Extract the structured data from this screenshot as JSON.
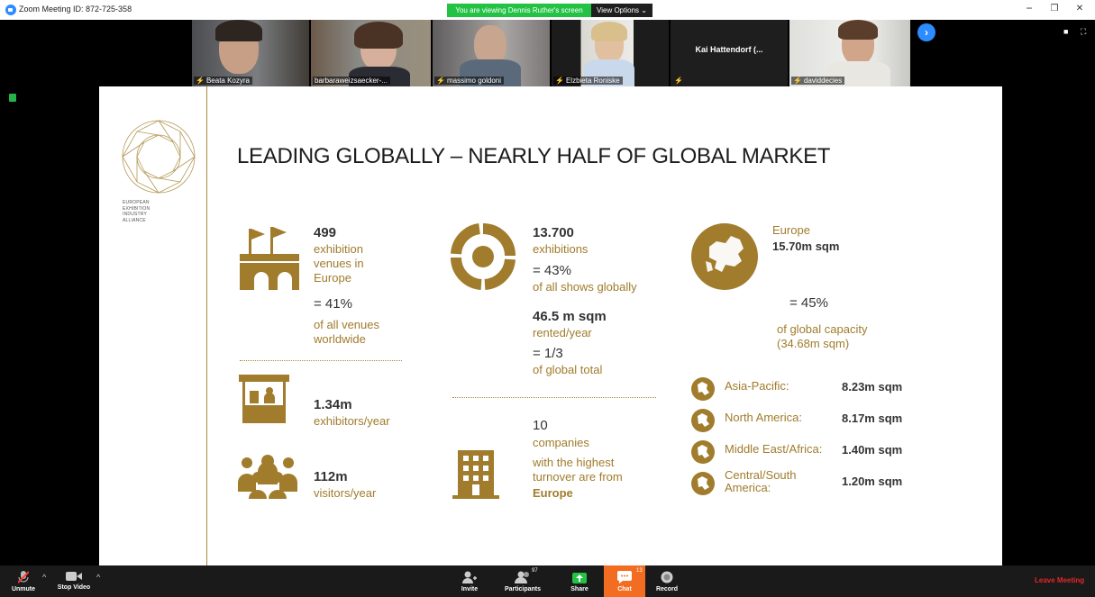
{
  "window": {
    "title": "Zoom Meeting ID: 872-725-358",
    "viewing_banner": "You are viewing Dennis Ruther's screen",
    "view_options": "View Options",
    "minimize": "−",
    "restore": "❐",
    "close": "✕"
  },
  "participants_strip": [
    {
      "name": "Beata Kozyra",
      "muted": true,
      "active": false
    },
    {
      "name": "barbaraweizsaecker-...",
      "muted": false,
      "active": true
    },
    {
      "name": "massimo goldoni",
      "muted": true,
      "active": false
    },
    {
      "name": "Elzbieta Roniske",
      "muted": true,
      "active": false
    },
    {
      "name": "Kai Hattendorf (...",
      "muted": true,
      "active": false
    },
    {
      "name": "daviddecies",
      "muted": true,
      "active": false
    }
  ],
  "slide": {
    "title": "LEADING GLOBALLY – NEARLY HALF OF GLOBAL MARKET",
    "org_lines": [
      "EUROPEAN",
      "EXHIBITION",
      "INDUSTRY",
      "ALLIANCE"
    ],
    "col1": {
      "venues_number": "499",
      "venues_text": [
        "exhibition",
        "venues in",
        "Europe"
      ],
      "venues_pct": "= 41%",
      "venues_pct_text": [
        "of all venues",
        "worldwide"
      ],
      "exhibitors_number": "1.34m",
      "exhibitors_text": "exhibitors/year",
      "visitors_number": "112m",
      "visitors_text": "visitors/year"
    },
    "col2": {
      "exhibitions_number": "13.700",
      "exhibitions_text": "exhibitions",
      "exhibitions_pct": "= 43%",
      "exhibitions_pct_text": "of all shows globally",
      "sqm_number": "46.5 m sqm",
      "sqm_text": "rented/year",
      "sqm_frac": "= 1/3",
      "sqm_frac_text": "of global total",
      "companies_number": "10",
      "companies_text": [
        "companies",
        "with the highest",
        "turnover are from"
      ],
      "companies_region": "Europe"
    },
    "col3": {
      "europe_label": "Europe",
      "europe_value": "15.70m sqm",
      "pct": "= 45%",
      "pct_text": [
        "of global capacity",
        "(34.68m sqm)"
      ],
      "regions": [
        {
          "name": "Asia-Pacific:",
          "value": "8.23m sqm"
        },
        {
          "name": "North America:",
          "value": "8.17m sqm"
        },
        {
          "name": "Middle East/Africa:",
          "value": "1.40m sqm"
        },
        {
          "name": "Central/South\nAmerica:",
          "value": "1.20m sqm"
        }
      ]
    }
  },
  "toolbar": {
    "unmute": "Unmute",
    "stop_video": "Stop Video",
    "invite": "Invite",
    "participants": "Participants",
    "participants_count": "97",
    "share": "Share",
    "chat": "Chat",
    "chat_count": "13",
    "record": "Record",
    "leave": "Leave Meeting"
  },
  "colors": {
    "accent_gold": "#9a7a2b",
    "share_green": "#23c244",
    "chat_orange": "#f26d21",
    "leave_red": "#e02828"
  }
}
